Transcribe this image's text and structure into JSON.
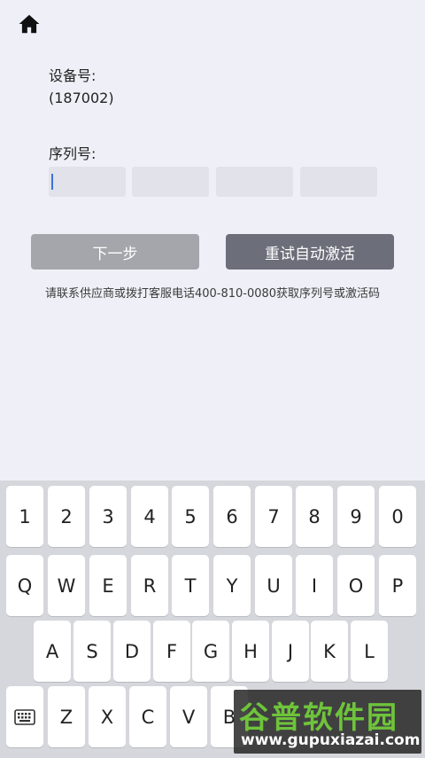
{
  "header": {
    "home_icon": "home-icon"
  },
  "device": {
    "label": "设备号:",
    "value": "(187002)"
  },
  "serial": {
    "label": "序列号:",
    "fields": [
      "",
      "",
      "",
      ""
    ]
  },
  "buttons": {
    "next": "下一步",
    "retry": "重试自动激活"
  },
  "hint": "请联系供应商或拨打客服电话400-810-0080获取序列号或激活码",
  "keyboard": {
    "row1": [
      "1",
      "2",
      "3",
      "4",
      "5",
      "6",
      "7",
      "8",
      "9",
      "0"
    ],
    "row2": [
      "Q",
      "W",
      "E",
      "R",
      "T",
      "Y",
      "U",
      "I",
      "O",
      "P"
    ],
    "row3": [
      "A",
      "S",
      "D",
      "F",
      "G",
      "H",
      "J",
      "K",
      "L"
    ],
    "row4": [
      "Z",
      "X",
      "C",
      "V",
      "B"
    ],
    "keyboard_toggle_icon": "keyboard-icon"
  },
  "watermark": {
    "title": "谷普软件园",
    "url": "www.gupuxiazai.com"
  },
  "colors": {
    "background": "#eff0f7",
    "next_button": "#a4a6ab",
    "retry_button": "#6c6f7a",
    "caret": "#3b73d8"
  }
}
